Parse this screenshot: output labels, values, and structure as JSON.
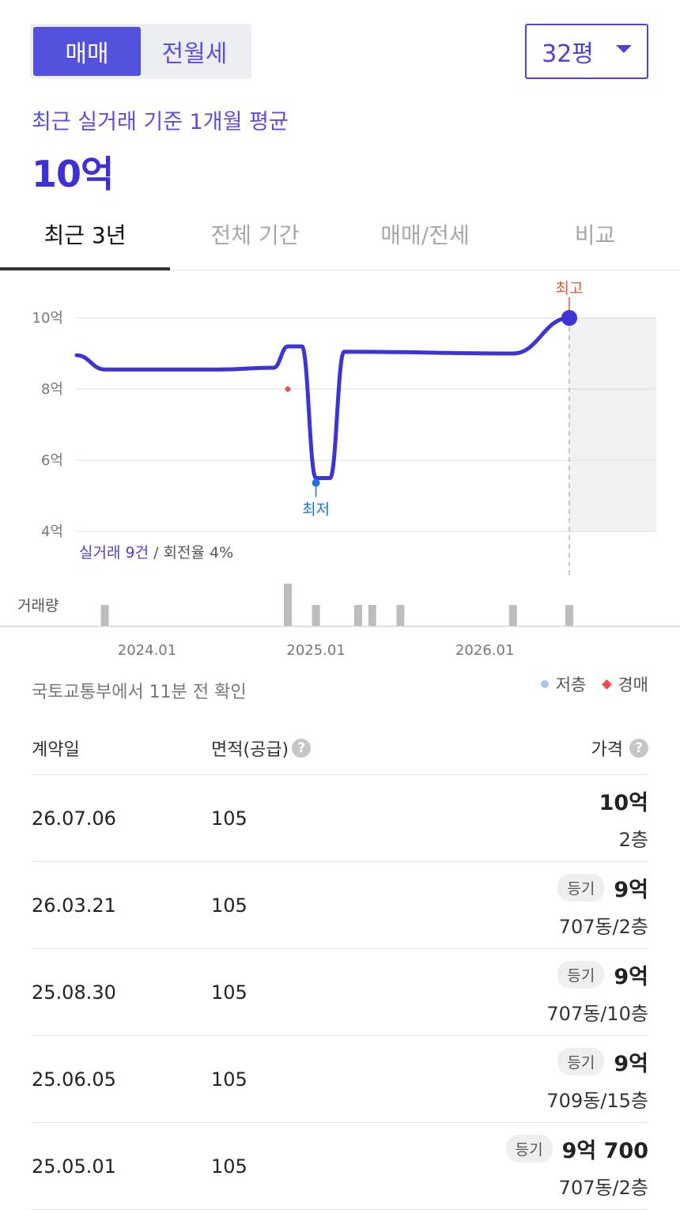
{
  "deal_toggle": {
    "sale": "매매",
    "rent": "전월세"
  },
  "area_select": {
    "value": "32평"
  },
  "summary": {
    "label": "최근 실거래 기준 1개월 평균",
    "value": "10억"
  },
  "tabs": [
    {
      "label": "최근 3년"
    },
    {
      "label": "전체 기간"
    },
    {
      "label": "매매/전세"
    },
    {
      "label": "비교"
    }
  ],
  "chart_data": {
    "type": "line",
    "y_ticks": [
      "10억",
      "8억",
      "6억",
      "4억"
    ],
    "y_tick_values": [
      10,
      8,
      6,
      4
    ],
    "ylim": [
      4,
      10
    ],
    "x_ticks": [
      "2024.01",
      "2025.01",
      "2026.01"
    ],
    "series": [
      {
        "values": [
          {
            "x": "2023.08",
            "y": 8.95
          },
          {
            "x": "2023.10",
            "y": 8.55
          },
          {
            "x": "2024.06",
            "y": 8.55
          },
          {
            "x": "2024.10",
            "y": 8.6
          },
          {
            "x": "2024.11",
            "y": 9.2
          },
          {
            "x": "2024.12",
            "y": 9.2
          },
          {
            "x": "2025.01",
            "y": 5.5
          },
          {
            "x": "2025.02",
            "y": 5.5
          },
          {
            "x": "2025.03",
            "y": 9.05
          },
          {
            "x": "2026.03",
            "y": 9.0
          },
          {
            "x": "2026.07",
            "y": 10.0
          }
        ]
      }
    ],
    "auction_point": {
      "x": "2024.11",
      "y": 8.0
    },
    "annotations": {
      "high": "최고",
      "low": "최저"
    },
    "trade_count_link": "실거래 9건",
    "turnover": " / 회전율 4%",
    "volume_label": "거래량",
    "volume": [
      {
        "x": "2023.10",
        "count": 1
      },
      {
        "x": "2024.11",
        "count": 2
      },
      {
        "x": "2025.01",
        "count": 1
      },
      {
        "x": "2025.04",
        "count": 1
      },
      {
        "x": "2025.05",
        "count": 1
      },
      {
        "x": "2025.07",
        "count": 1
      },
      {
        "x": "2026.03",
        "count": 1
      },
      {
        "x": "2026.07",
        "count": 1
      }
    ],
    "colors": {
      "line": "#3e34d6",
      "high": "#e4572e",
      "low": "#1a73e8",
      "auction": "#f04a4a",
      "volume": "#bdbdbd",
      "future_band": "#f2f2f2"
    }
  },
  "source_note": "국토교통부에서 11분 전 확인",
  "legend": {
    "low_floor": "저층",
    "auction": "경매"
  },
  "table": {
    "headers": {
      "date": "계약일",
      "area": "면적(공급)",
      "price": "가격"
    },
    "rows": [
      {
        "date": "26.07.06",
        "area": "105",
        "badge": "",
        "price": "10억",
        "floor": "2층"
      },
      {
        "date": "26.03.21",
        "area": "105",
        "badge": "등기",
        "price": "9억",
        "floor": "707동/2층"
      },
      {
        "date": "25.08.30",
        "area": "105",
        "badge": "등기",
        "price": "9억",
        "floor": "707동/10층"
      },
      {
        "date": "25.06.05",
        "area": "105",
        "badge": "등기",
        "price": "9억",
        "floor": "709동/15층"
      },
      {
        "date": "25.05.01",
        "area": "105",
        "badge": "등기",
        "price": "9억 700",
        "floor": "707동/2층"
      }
    ]
  }
}
